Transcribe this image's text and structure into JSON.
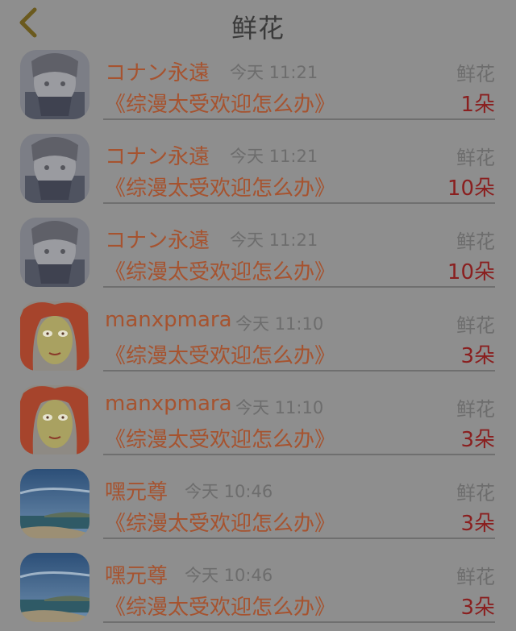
{
  "header": {
    "title": "鲜花",
    "back_icon": "chevron-left-icon"
  },
  "colors": {
    "background": "#8e8e8e",
    "accent": "#a6532f",
    "count": "#8a1f1f",
    "muted": "#6d6d6d"
  },
  "rows": [
    {
      "avatar": "photo-person-avatar",
      "name": "コナン永遠",
      "time": "今天 11:21",
      "gift_type": "鲜花",
      "book": "《综漫太受欢迎怎么办》",
      "count": "1朵"
    },
    {
      "avatar": "photo-person-avatar",
      "name": "コナン永遠",
      "time": "今天 11:21",
      "gift_type": "鲜花",
      "book": "《综漫太受欢迎怎么办》",
      "count": "10朵"
    },
    {
      "avatar": "photo-person-avatar",
      "name": "コナン永遠",
      "time": "今天 11:21",
      "gift_type": "鲜花",
      "book": "《综漫太受欢迎怎么办》",
      "count": "10朵"
    },
    {
      "avatar": "drawn-face-avatar",
      "name": "manxpmara",
      "time": "今天 11:10",
      "gift_type": "鲜花",
      "book": "《综漫太受欢迎怎么办》",
      "count": "3朵"
    },
    {
      "avatar": "drawn-face-avatar",
      "name": "manxpmara",
      "time": "今天 11:10",
      "gift_type": "鲜花",
      "book": "《综漫太受欢迎怎么办》",
      "count": "3朵"
    },
    {
      "avatar": "beach-avatar",
      "name": "嘿元尊",
      "time": "今天 10:46",
      "gift_type": "鲜花",
      "book": "《综漫太受欢迎怎么办》",
      "count": "3朵"
    },
    {
      "avatar": "beach-avatar",
      "name": "嘿元尊",
      "time": "今天 10:46",
      "gift_type": "鲜花",
      "book": "《综漫太受欢迎怎么办》",
      "count": "3朵"
    }
  ]
}
